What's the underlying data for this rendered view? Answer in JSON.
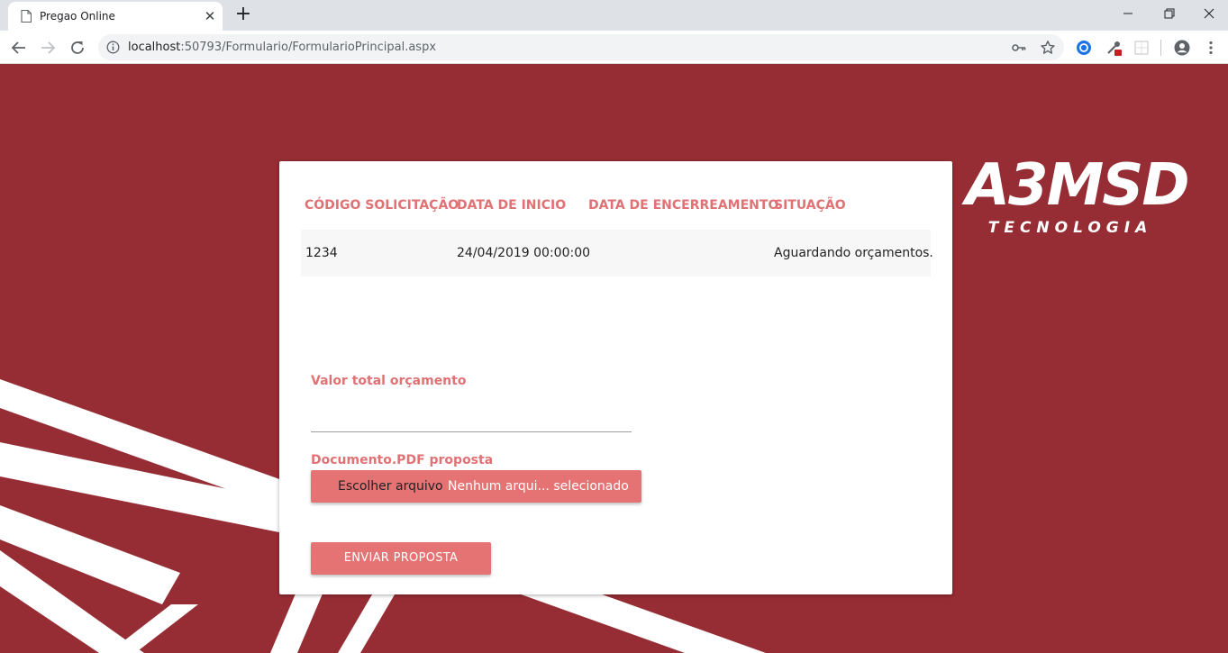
{
  "browser": {
    "tab_title": "Pregao Online",
    "tab_close": "✕",
    "new_tab": "+",
    "url_host": "localhost",
    "url_rest": ":50793/Formulario/FormularioPrincipal.aspx"
  },
  "brand": {
    "logo_main": "A3MSD",
    "logo_sub": "TECNOLOGIA",
    "background_color": "#962d34",
    "accent_color": "#e57373",
    "heading_color": "#e07275"
  },
  "table": {
    "headers": [
      "CÓDIGO SOLICITAÇÃO",
      "DATA DE INICIO",
      "DATA DE ENCERREAMENTO",
      "SITUAÇÃO"
    ],
    "rows": [
      [
        "1234",
        "24/04/2019 00:00:00",
        "",
        "Aguardando orçamentos."
      ]
    ]
  },
  "form": {
    "valor_label": "Valor total orçamento",
    "valor_value": "",
    "documento_label": "Documento.PDF proposta",
    "file_button": "Escolher arquivo",
    "file_status": "Nenhum arqui... selecionado",
    "submit_label": "ENVIAR PROPOSTA"
  }
}
